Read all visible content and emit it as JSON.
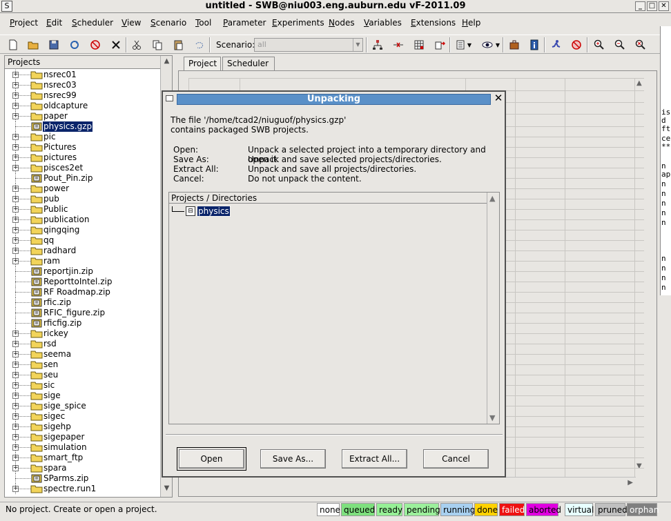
{
  "window": {
    "title": "untitled - SWB@niu003.eng.auburn.edu vF-2011.09",
    "sys_glyph": "S",
    "min": "_",
    "max": "□",
    "close": "✕"
  },
  "menu": [
    "Project",
    "Edit",
    "Scheduler",
    "View",
    "Scenario",
    "Tool",
    "Parameter",
    "Experiments",
    "Nodes",
    "Variables",
    "Extensions",
    "Help"
  ],
  "toolbar": {
    "scenario_label": "Scenario:",
    "scenario_value": "all",
    "icons": [
      "new-project-icon",
      "open-folder-icon",
      "save-icon",
      "refresh-icon",
      "no-entry-icon",
      "delete-icon",
      "cut-icon",
      "copy-icon",
      "paste-icon",
      "undo-icon",
      "node-add-icon",
      "node-remove-icon",
      "grid-icon",
      "grid-arrow-icon",
      "table-icon",
      "eye-icon",
      "toolbox-icon",
      "info-icon",
      "runner-icon",
      "abort-icon",
      "zoom-in-icon",
      "zoom-out-icon",
      "zoom-reset-icon"
    ]
  },
  "projects_panel": {
    "header": "Projects",
    "items": [
      {
        "label": "nsrec01",
        "type": "folder"
      },
      {
        "label": "nsrec03",
        "type": "folder"
      },
      {
        "label": "nsrec99",
        "type": "folder"
      },
      {
        "label": "oldcapture",
        "type": "folder"
      },
      {
        "label": "paper",
        "type": "folder"
      },
      {
        "label": "physics.gzp",
        "type": "package",
        "selected": true
      },
      {
        "label": "pic",
        "type": "folder"
      },
      {
        "label": "Pictures",
        "type": "folder"
      },
      {
        "label": "pictures",
        "type": "folder"
      },
      {
        "label": "pisces2et",
        "type": "folder"
      },
      {
        "label": "Pout_Pin.zip",
        "type": "package"
      },
      {
        "label": "power",
        "type": "folder"
      },
      {
        "label": "pub",
        "type": "folder"
      },
      {
        "label": "Public",
        "type": "folder"
      },
      {
        "label": "publication",
        "type": "folder"
      },
      {
        "label": "qingqing",
        "type": "folder"
      },
      {
        "label": "qq",
        "type": "folder"
      },
      {
        "label": "radhard",
        "type": "folder"
      },
      {
        "label": "ram",
        "type": "folder"
      },
      {
        "label": "reportjin.zip",
        "type": "package"
      },
      {
        "label": "ReporttoIntel.zip",
        "type": "package"
      },
      {
        "label": "RF Roadmap.zip",
        "type": "package"
      },
      {
        "label": "rfic.zip",
        "type": "package"
      },
      {
        "label": "RFIC_figure.zip",
        "type": "package"
      },
      {
        "label": "rficfig.zip",
        "type": "package"
      },
      {
        "label": "rickey",
        "type": "folder"
      },
      {
        "label": "rsd",
        "type": "folder"
      },
      {
        "label": "seema",
        "type": "folder"
      },
      {
        "label": "sen",
        "type": "folder"
      },
      {
        "label": "seu",
        "type": "folder"
      },
      {
        "label": "sic",
        "type": "folder"
      },
      {
        "label": "sige",
        "type": "folder"
      },
      {
        "label": "sige_spice",
        "type": "folder"
      },
      {
        "label": "sigec",
        "type": "folder"
      },
      {
        "label": "sigehp",
        "type": "folder"
      },
      {
        "label": "sigepaper",
        "type": "folder"
      },
      {
        "label": "simulation",
        "type": "folder"
      },
      {
        "label": "smart_ftp",
        "type": "folder"
      },
      {
        "label": "spara",
        "type": "folder"
      },
      {
        "label": "SParms.zip",
        "type": "package"
      },
      {
        "label": "spectre.run1",
        "type": "folder"
      }
    ]
  },
  "tabs": [
    "Project",
    "Scheduler"
  ],
  "right_strip": [
    "is",
    "d",
    "ft",
    "ce",
    "**",
    "n",
    "ap",
    "n",
    "n",
    "n",
    "n",
    "n",
    "n",
    "n",
    "n",
    "n",
    "n"
  ],
  "dialog": {
    "title": "Unpacking",
    "close": "✕",
    "message_line1": "The file '/home/tcad2/niuguof/physics.gzp'",
    "message_line2": "contains packaged SWB projects.",
    "options": [
      {
        "name": "Open:",
        "desc": "Unpack a selected project into a temporary directory and open it."
      },
      {
        "name": "Save As:",
        "desc": "Unpack and save selected projects/directories."
      },
      {
        "name": "Extract All:",
        "desc": "Unpack and save all projects/directories."
      },
      {
        "name": "Cancel:",
        "desc": "Do not unpack the content."
      }
    ],
    "list_header": "Projects / Directories",
    "list_items": [
      "physics"
    ],
    "buttons": [
      "Open",
      "Save As...",
      "Extract All...",
      "Cancel"
    ]
  },
  "status": {
    "text": "No project. Create or open a project.",
    "legend": [
      {
        "label": "none",
        "color": "#ffffff"
      },
      {
        "label": "queued",
        "color": "#7ee07e"
      },
      {
        "label": "ready",
        "color": "#96f096"
      },
      {
        "label": "pending",
        "color": "#9cf09c"
      },
      {
        "label": "running",
        "color": "#a8d0f0"
      },
      {
        "label": "done",
        "color": "#ffd200"
      },
      {
        "label": "failed",
        "color": "#ee1111"
      },
      {
        "label": "aborted",
        "color": "#e000e0"
      },
      {
        "label": "virtual",
        "color": "#e8ffff"
      },
      {
        "label": "pruned",
        "color": "#c0c0c0"
      },
      {
        "label": "orphan",
        "color": "#808080"
      }
    ]
  }
}
